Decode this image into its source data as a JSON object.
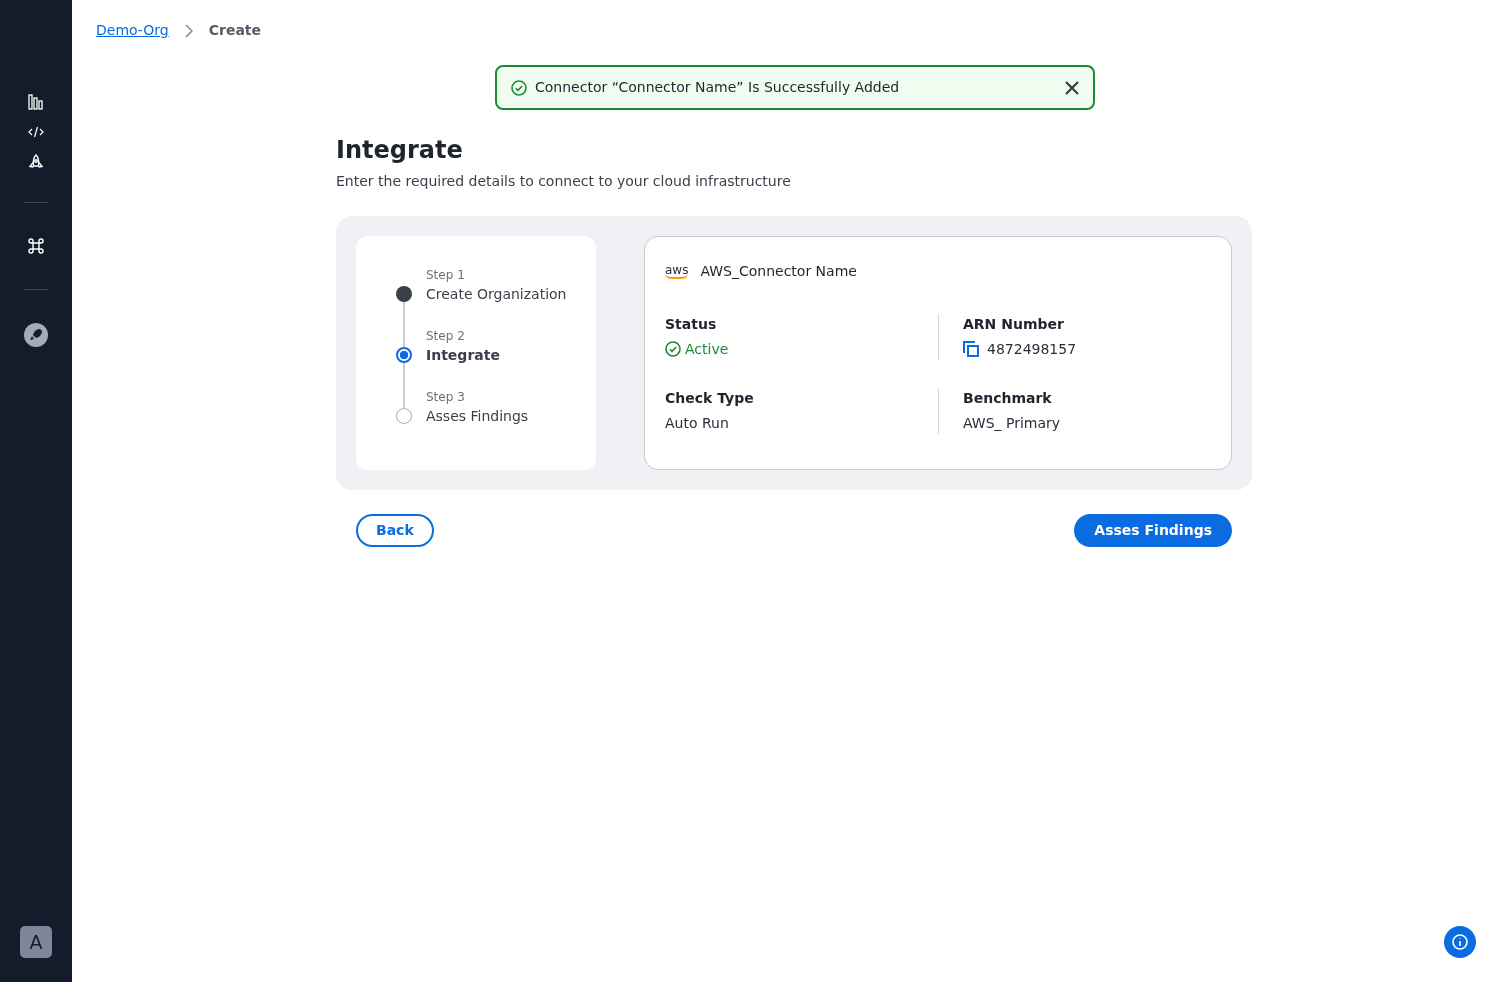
{
  "sidebar": {
    "user_initial": "A"
  },
  "breadcrumb": [
    {
      "label": "Demo-Org",
      "kind": "link"
    },
    {
      "label": "Create",
      "kind": "current"
    }
  ],
  "toast": {
    "message": "Connector “Connector Name” Is Successfully Added"
  },
  "header": {
    "title": "Integrate",
    "subtitle": "Enter the required details to connect  to your cloud infrastructure"
  },
  "steps": [
    {
      "step": "Step 1",
      "label": "Create Organization",
      "completed": true,
      "selected": false
    },
    {
      "step": "Step 2",
      "label": "Integrate",
      "completed": false,
      "selected": true
    },
    {
      "step": "Step 3",
      "label": "Asses Findings",
      "completed": false,
      "selected": false
    }
  ],
  "connector": {
    "logo_text": "aws",
    "name": "AWS_Connector Name",
    "fields": [
      {
        "label": "Status",
        "value": "Active",
        "kind": "status"
      },
      {
        "label": "ARN Number",
        "value": "4872498157",
        "kind": "copy"
      },
      {
        "label": "Check Type",
        "value": "Auto Run",
        "kind": "plain"
      },
      {
        "label": "Benchmark",
        "value": "AWS_ Primary",
        "kind": "plain"
      }
    ]
  },
  "buttons": [
    {
      "label": "Back",
      "kind": "outline"
    },
    {
      "label": "Asses Findings",
      "kind": "primary"
    }
  ]
}
